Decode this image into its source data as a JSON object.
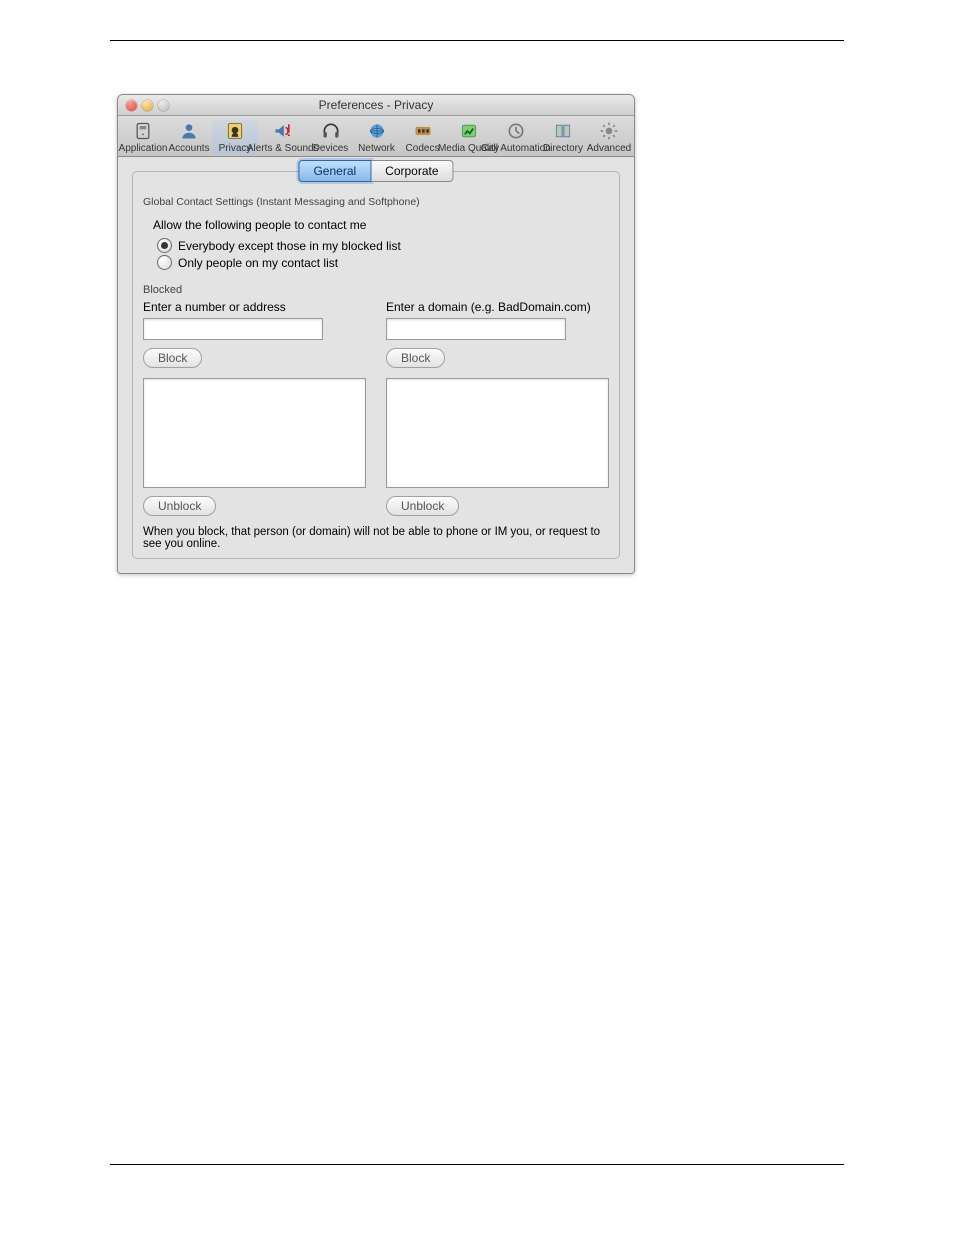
{
  "window": {
    "title": "Preferences - Privacy"
  },
  "toolbar": {
    "items": [
      {
        "label": "Application",
        "icon": "application"
      },
      {
        "label": "Accounts",
        "icon": "accounts"
      },
      {
        "label": "Privacy",
        "icon": "privacy"
      },
      {
        "label": "Alerts & Sounds",
        "icon": "alerts"
      },
      {
        "label": "Devices",
        "icon": "devices"
      },
      {
        "label": "Network",
        "icon": "network"
      },
      {
        "label": "Codecs",
        "icon": "codecs"
      },
      {
        "label": "Media Quality",
        "icon": "media"
      },
      {
        "label": "Call Automation",
        "icon": "automation"
      },
      {
        "label": "Directory",
        "icon": "directory"
      },
      {
        "label": "Advanced",
        "icon": "advanced"
      }
    ],
    "selected_index": 2
  },
  "tabs": {
    "items": [
      "General",
      "Corporate"
    ],
    "selected": 0
  },
  "global_settings": {
    "section_label": "Global Contact Settings (Instant Messaging and Softphone)",
    "allow_label": "Allow the following people to contact me",
    "radio_options": [
      "Everybody except those in my blocked list",
      "Only people on my contact list"
    ],
    "selected_radio": 0
  },
  "blocked": {
    "section_label": "Blocked",
    "left": {
      "field_label": "Enter a number or address",
      "block_button": "Block",
      "unblock_button": "Unblock",
      "value": ""
    },
    "right": {
      "field_label": "Enter a domain (e.g. BadDomain.com)",
      "block_button": "Block",
      "unblock_button": "Unblock",
      "value": ""
    },
    "footnote": "When you block, that person (or domain) will not be able to phone or IM you, or request to see you online."
  }
}
